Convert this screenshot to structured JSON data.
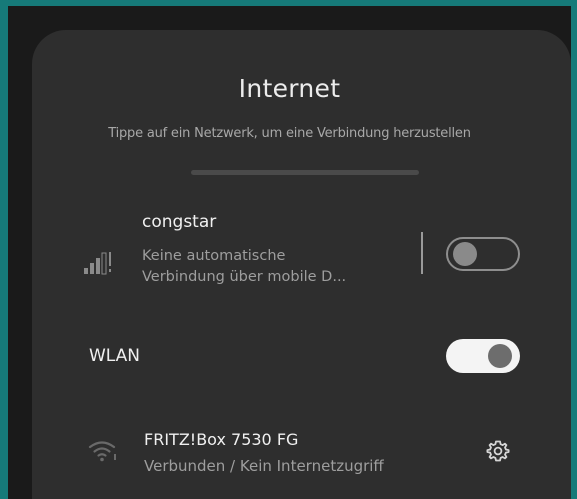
{
  "header": {
    "title": "Internet",
    "subtitle": "Tippe auf ein Netzwerk, um eine Verbindung herzustellen"
  },
  "mobile": {
    "name": "congstar",
    "status_line1": "Keine automatische",
    "status_line2": "Verbindung über mobile D...",
    "icon": "cellular-signal-icon",
    "toggle_state": "off"
  },
  "wlan": {
    "label": "WLAN",
    "toggle_state": "on"
  },
  "wifi_network": {
    "name": "FRITZ!Box 7530 FG",
    "status": "Verbunden / Kein Internetzugriff",
    "icon": "wifi-icon",
    "settings_icon": "gear-icon"
  },
  "colors": {
    "sheet_background": "#2e2e2e",
    "toggle_on_track": "#f4f4f4",
    "toggle_off_border": "#8e8e8e"
  }
}
